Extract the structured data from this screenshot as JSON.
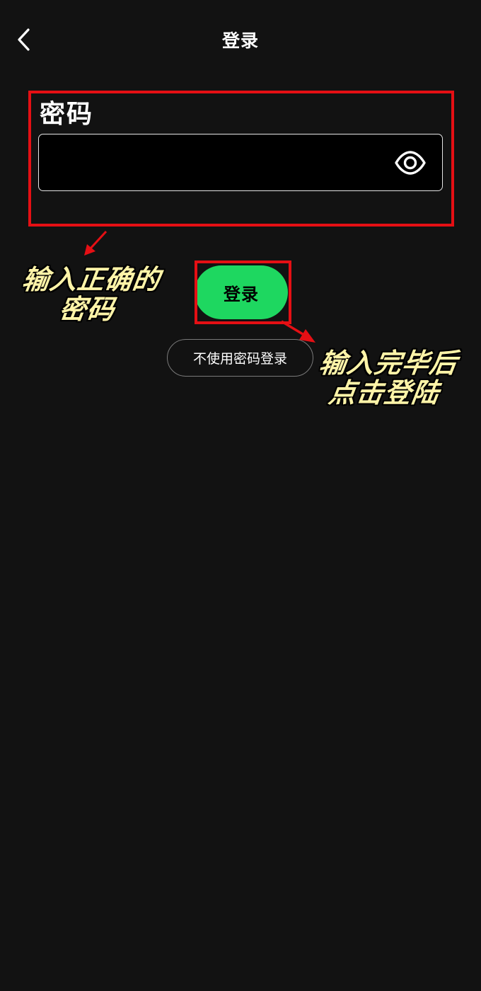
{
  "header": {
    "title": "登录",
    "back_icon": "chevron-left-icon"
  },
  "password": {
    "label": "密码",
    "value": "",
    "toggle_icon": "eye-icon"
  },
  "actions": {
    "login_label": "登录",
    "no_password_label": "不使用密码登录"
  },
  "annotations": {
    "left_line1": "输入正确的",
    "left_line2": "密码",
    "right_line1": "输入完毕后",
    "right_line2": "点击登陆",
    "highlight_color": "#e50f14",
    "text_color": "#fff4a8"
  },
  "colors": {
    "background": "#121212",
    "accent": "#1ed760"
  }
}
